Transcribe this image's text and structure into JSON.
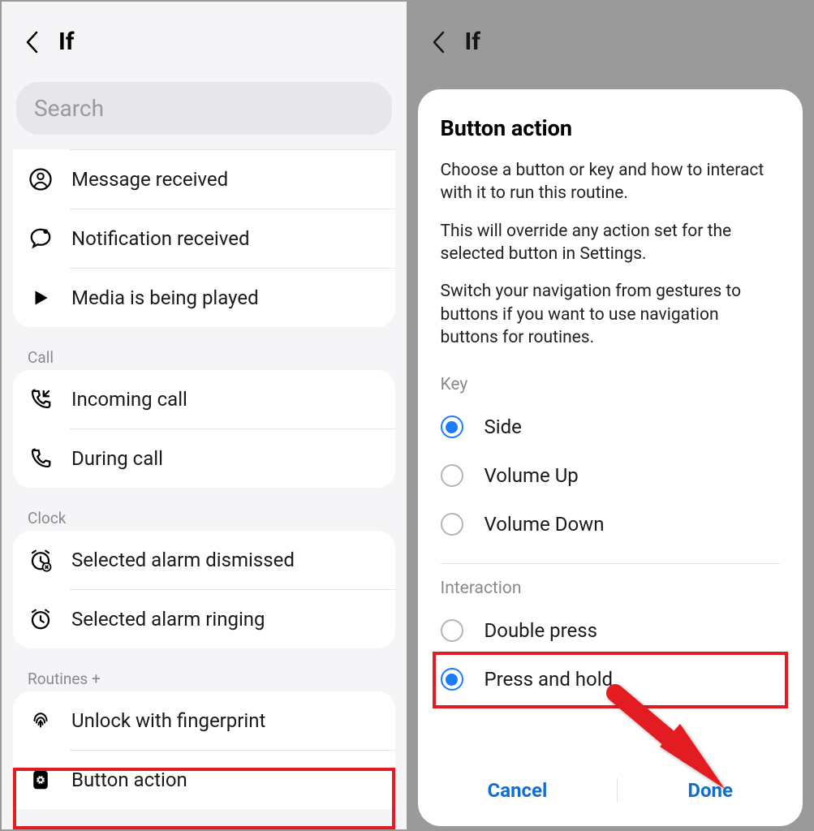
{
  "left": {
    "title": "If",
    "search_placeholder": "Search",
    "groups": {
      "top": {
        "items": [
          {
            "label": "Message received",
            "icon": "message-user-icon"
          },
          {
            "label": "Notification received",
            "icon": "chat-bubble-icon"
          },
          {
            "label": "Media is being played",
            "icon": "play-icon"
          }
        ]
      },
      "call": {
        "header": "Call",
        "items": [
          {
            "label": "Incoming call",
            "icon": "incoming-call-icon"
          },
          {
            "label": "During call",
            "icon": "phone-icon"
          }
        ]
      },
      "clock": {
        "header": "Clock",
        "items": [
          {
            "label": "Selected alarm dismissed",
            "icon": "alarm-dismissed-icon"
          },
          {
            "label": "Selected alarm ringing",
            "icon": "alarm-ringing-icon"
          }
        ]
      },
      "routines": {
        "header": "Routines +",
        "items": [
          {
            "label": "Unlock with fingerprint",
            "icon": "fingerprint-icon"
          },
          {
            "label": "Button action",
            "icon": "button-gear-icon"
          }
        ]
      }
    }
  },
  "right": {
    "title": "If",
    "modal": {
      "title": "Button action",
      "desc1": "Choose a button or key and how to interact with it to run this routine.",
      "desc2": "This will override any action set for the selected button in Settings.",
      "desc3": "Switch your navigation from gestures to buttons if you want to use navigation buttons for routines.",
      "key_label": "Key",
      "key_options": [
        {
          "label": "Side",
          "selected": true
        },
        {
          "label": "Volume Up",
          "selected": false
        },
        {
          "label": "Volume Down",
          "selected": false
        }
      ],
      "interaction_label": "Interaction",
      "interaction_options": [
        {
          "label": "Double press",
          "selected": false
        },
        {
          "label": "Press and hold",
          "selected": true
        }
      ],
      "cancel": "Cancel",
      "done": "Done"
    }
  }
}
